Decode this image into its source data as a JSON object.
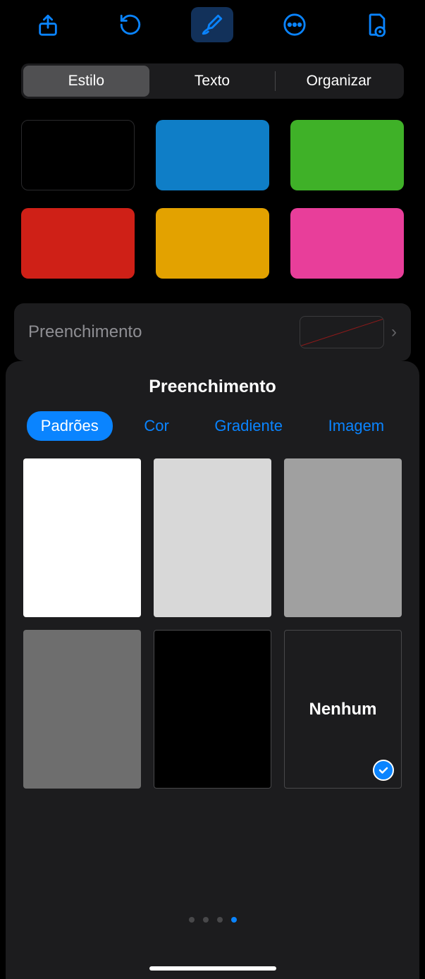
{
  "toolbar": {
    "icons": [
      "share",
      "undo",
      "format",
      "more",
      "document"
    ]
  },
  "tabs": {
    "items": [
      "Estilo",
      "Texto",
      "Organizar"
    ],
    "selected": 0
  },
  "styleSwatches": {
    "colors": [
      "#000000",
      "#0f7ec7",
      "#3fb128",
      "#cf2017",
      "#e3a200",
      "#e83e9a"
    ]
  },
  "fillRow": {
    "label": "Preenchimento"
  },
  "sheet": {
    "title": "Preenchimento",
    "tabs": [
      "Padrões",
      "Cor",
      "Gradiente",
      "Imagem"
    ],
    "selectedTab": 0,
    "patterns": {
      "colors": [
        "#ffffff",
        "#d8d8d8",
        "#a0a0a0",
        "#6e6e6e",
        "#000000"
      ],
      "noneLabel": "Nenhum",
      "selectedIndex": 5
    },
    "pageDots": {
      "count": 4,
      "active": 3
    }
  }
}
